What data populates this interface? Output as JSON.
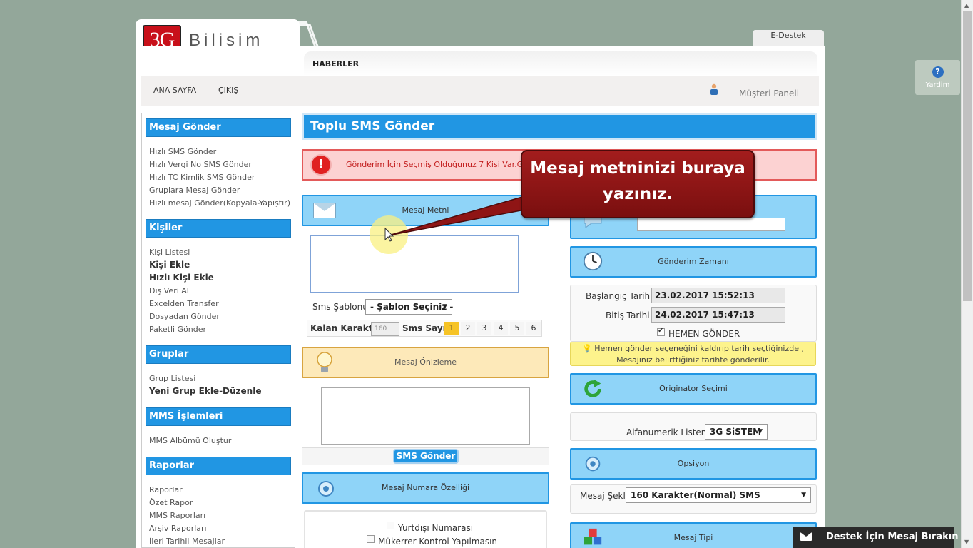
{
  "header": {
    "logo_mark": "3G",
    "logo_text": "Bilişim",
    "news_tab": "HABERLER",
    "support_tab": "E-Destek"
  },
  "nav": {
    "home": "ANA SAYFA",
    "logout": "ÇIKIŞ",
    "customer_panel": "Müşteri Paneli"
  },
  "help": {
    "label": "Yardim",
    "glyph": "?"
  },
  "sidebar": {
    "sections": [
      {
        "title": "Mesaj Gönder",
        "items": [
          "Hızlı SMS Gönder",
          "Hızlı Vergi No SMS Gönder",
          "Hızlı TC Kimlik SMS Gönder",
          "Gruplara Mesaj Gönder",
          "Hızlı mesaj Gönder(Kopyala-Yapıştır)"
        ]
      },
      {
        "title": "Kişiler",
        "items": [
          "Kişi Listesi",
          "Kişi Ekle",
          "Hızlı Kişi Ekle",
          "Dış Veri Al",
          "Excelden Transfer",
          "Dosyadan Gönder",
          "Paketli Gönder"
        ]
      },
      {
        "title": "Gruplar",
        "items": [
          "Grup Listesi",
          "Yeni Grup Ekle-Düzenle"
        ]
      },
      {
        "title": "MMS İşlemleri",
        "items": [
          "MMS Albümü Oluştur"
        ]
      },
      {
        "title": "Raporlar",
        "items": [
          "Raporlar",
          "Özet Rapor",
          "MMS Raporları",
          "Arşiv Raporları",
          "İleri Tarihli Mesajlar"
        ]
      }
    ]
  },
  "main": {
    "title": "Toplu SMS Gönder",
    "alert_text": "Gönderim İçin Seçmiş Olduğunuz 7 Kişi Var.Gö",
    "alert_glyph": "!",
    "message_panel": "Mesaj Metni",
    "template_label": "Sms Şablonu:",
    "template_value": "- Şablon Seçiniz -",
    "remaining_label": "Kalan Karakter",
    "remaining_value": "160",
    "sms_count_label": "Sms Sayısı",
    "sms_counts": [
      "1",
      "2",
      "3",
      "4",
      "5",
      "6"
    ],
    "preview_panel": "Mesaj Önizleme",
    "send_button": "SMS Gönder",
    "number_panel": "Mesaj Numara Özelliği",
    "foreign_number": "Yurtdışı Numarası",
    "duplicate_check": "Mükerrer Kontrol Yapılmasın"
  },
  "right": {
    "schedule_panel": "Gönderim Zamanı",
    "start_label": "Başlangıç Tarihi :",
    "start_value": "23.02.2017 15:52:13",
    "end_label": "Bitiş Tarihi :",
    "end_value": "24.02.2017 15:47:13",
    "send_now": "HEMEN GÖNDER",
    "note_line1": "Hemen gönder seçeneğini kaldırıp tarih seçtiğinizde ,",
    "note_line2": "Mesajınız belirttiğiniz tarihte gönderilir.",
    "originator_panel": "Originator Seçimi",
    "alpha_label": "Alfanumerik Listeniz",
    "alpha_value": "3G SiSTEM",
    "option_panel": "Opsiyon",
    "message_type_label": "Mesaj Şekli :",
    "message_type_value": "160 Karakter(Normal) SMS",
    "message_kind_panel": "Mesaj Tipi"
  },
  "callout": {
    "line1": "Mesaj metninizi buraya",
    "line2": "yazınız."
  },
  "support_chat": "Destek İçin Mesaj Bırakın",
  "colors": {
    "accent": "#2196e3",
    "panel": "#8fd4f8",
    "alert_bg": "#fcd2d2",
    "callout": "#8f1515"
  }
}
